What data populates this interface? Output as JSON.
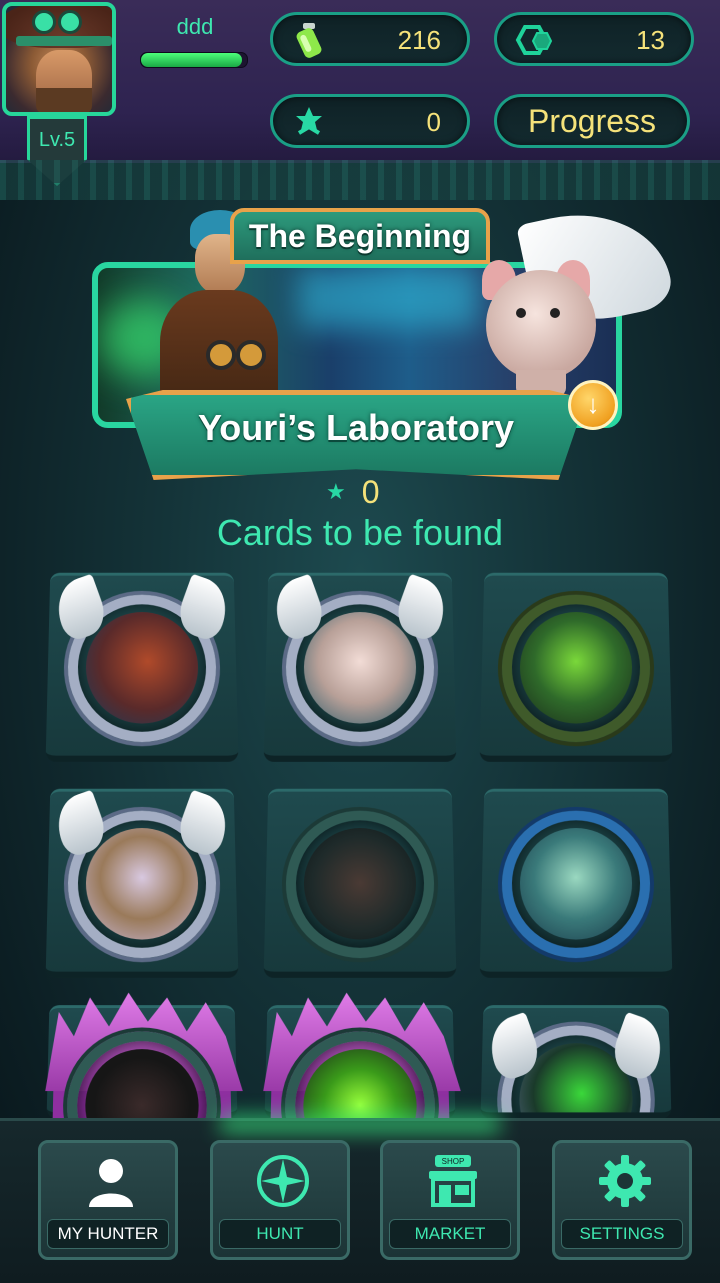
{
  "player": {
    "name": "ddd",
    "level": "Lv.5",
    "xp_fraction": 0.95
  },
  "currencies": {
    "energy": "216",
    "gems": "13",
    "stars": "0"
  },
  "progress_button": "Progress",
  "chapter": {
    "title": "The Beginning",
    "location": "Youri’s Laboratory",
    "stars": "0",
    "cards_label": "Cards to be found"
  },
  "cards": [
    {
      "name": "lightning-serpent",
      "state": "found-winged"
    },
    {
      "name": "winged-rat",
      "state": "found-winged"
    },
    {
      "name": "vine-beast",
      "state": "vine-frame"
    },
    {
      "name": "griffin",
      "state": "found-winged"
    },
    {
      "name": "shadow-wolf",
      "state": "locked"
    },
    {
      "name": "mech-fish",
      "state": "blue-frame"
    },
    {
      "name": "dark-creature",
      "state": "crystal"
    },
    {
      "name": "green-spirit",
      "state": "crystal"
    },
    {
      "name": "green-robot",
      "state": "found-winged"
    }
  ],
  "nav": {
    "my_hunter": "MY HUNTER",
    "hunt": "HUNT",
    "market": "MARKET",
    "market_sign": "SHOP",
    "settings": "SETTINGS"
  },
  "colors": {
    "accent": "#3ee8b0",
    "currency_text": "#f5e27a",
    "frame_gold": "#e8a24a"
  }
}
